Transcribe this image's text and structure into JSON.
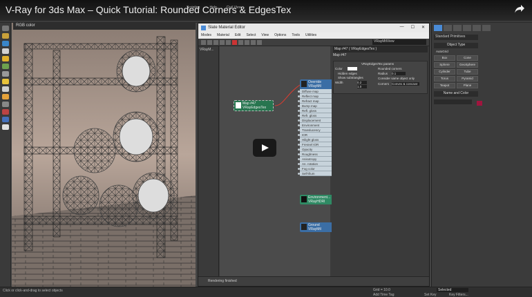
{
  "video_title": "V-Ray for 3ds Max – Quick Tutorial: Rounded Corners & EdgesTex",
  "max_menu": [
    "Scripting",
    "Help",
    "Civil View"
  ],
  "viewport": {
    "label": "RGB color"
  },
  "slate": {
    "title": "Slate Material Editor",
    "menus": [
      "Modes",
      "Material",
      "Edit",
      "Select",
      "View",
      "Options",
      "Tools",
      "Utilities"
    ],
    "view_combo": "VRayMtlView",
    "browser_header": "VRayM...",
    "nodes": {
      "edgestex": {
        "title": "Map #47",
        "subtitle": "VRayEdgesTex"
      },
      "mtl": {
        "title": "Override",
        "subtitle": "VRayMtl",
        "slots": [
          "Diffuse map",
          "Reflect map",
          "Refract map",
          "Bump map",
          "Refl. gloss",
          "Refr. gloss",
          "Displacement",
          "Environment",
          "Translucency",
          "IOR",
          "Hilight gloss",
          "Fresnel IOR",
          "Opacity",
          "Roughness",
          "Anisotropy",
          "An. rotation",
          "Fog color",
          "Self-illum"
        ]
      },
      "env": {
        "title": "Environment...",
        "subtitle": "VRayHDRI"
      },
      "ground": {
        "title": "Ground",
        "subtitle": "VRayMtl"
      }
    },
    "params": {
      "rollout": "Map #47  ( VRayEdgesTex )",
      "sub": "Map #47",
      "section": "VRayEdgesTex params",
      "color_label": "Color",
      "rounded_label": "Rounded corners",
      "radius_label": "Radius",
      "radius_value": "0.1",
      "consider_label": "Consider same object only",
      "corners_label": "Corners",
      "corners_value": "Convex & concave",
      "hidden_label": "Hidden edges",
      "show_sub_label": "Show subtriangles",
      "width_label": "Width",
      "width_value": "0.2",
      "w2_value": "1.0"
    },
    "status": "Rendering finished"
  },
  "cmd": {
    "combo": "Standard Primitives",
    "sec1": "Object Type",
    "autogrid": "AutoGrid",
    "buttons": [
      "Box",
      "Cone",
      "Sphere",
      "GeoSphere",
      "Cylinder",
      "Tube",
      "Torus",
      "Pyramid",
      "Teapot",
      "Plane"
    ],
    "sec2": "Name and Color"
  },
  "bottom": {
    "left": "Click or click-and-drag to select objects",
    "grid": "Grid = 10.0",
    "addtime": "Add Time Tag",
    "selected": "Selected",
    "setkey": "Set Key",
    "keyfilters": "Key Filters..."
  },
  "colors": {
    "node_edges": "#2e8b57",
    "node_mtl": "#3b6ea5",
    "env_green": "#2f8a64",
    "accent": "#4a8bd6"
  }
}
